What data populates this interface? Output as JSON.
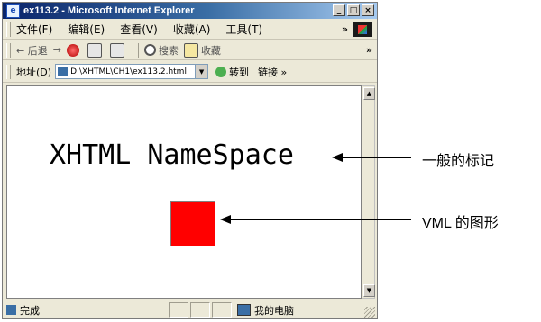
{
  "window": {
    "title": "ex113.2 - Microsoft Internet Explorer",
    "controls": [
      "_",
      "□",
      "×"
    ]
  },
  "menubar": {
    "items": [
      "文件(F)",
      "编辑(E)",
      "查看(V)",
      "收藏(A)",
      "工具(T)"
    ],
    "more": "»"
  },
  "toolbar": {
    "back": "← 后退",
    "forward": "→",
    "search": "搜索",
    "favorites": "收藏",
    "more": "»"
  },
  "addressbar": {
    "label": "地址(D)",
    "value": "D:\\XHTML\\CH1\\ex113.2.html",
    "go": "转到",
    "links": "链接 »"
  },
  "content": {
    "heading": "XHTML NameSpace",
    "shape_color": "#ff0000"
  },
  "statusbar": {
    "status": "完成",
    "zone": "我的电脑"
  },
  "annotations": {
    "label1": "一般的标记",
    "label2": "VML 的图形"
  }
}
